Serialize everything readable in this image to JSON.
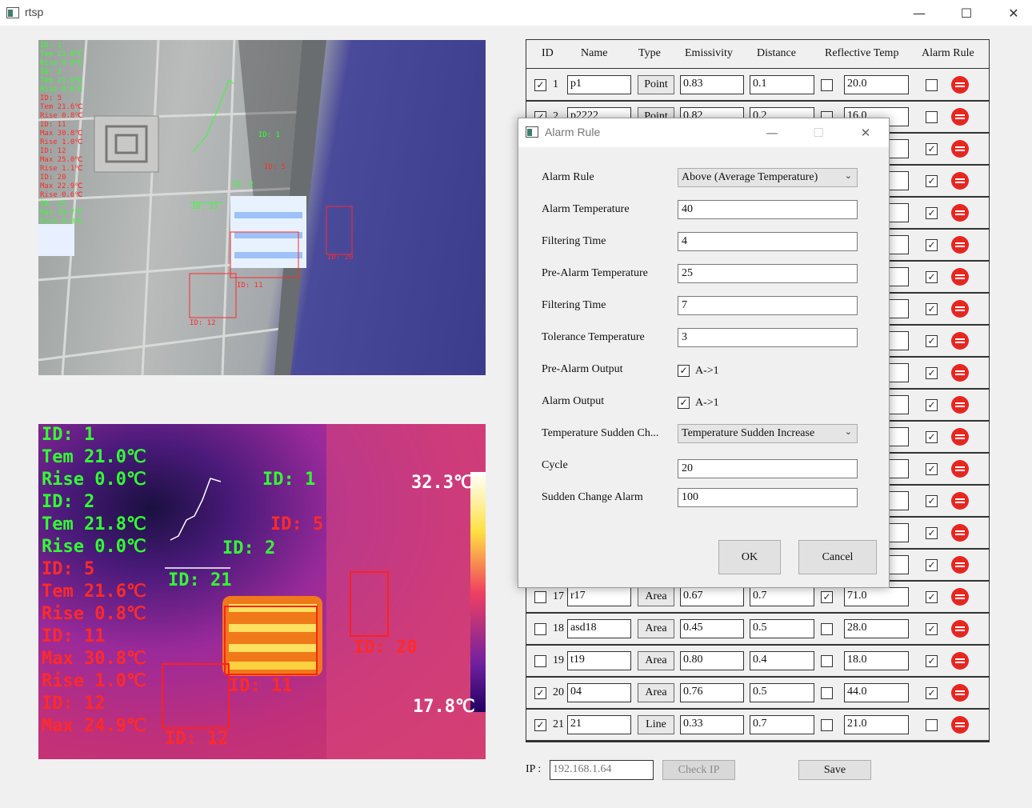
{
  "window": {
    "title": "rtsp",
    "minimize": "—",
    "maximize": "☐",
    "close": "✕"
  },
  "visible_view": {
    "overlay_lines": [
      {
        "text": "ID: 1",
        "color": "g"
      },
      {
        "text": "Tem  21.0℃",
        "color": "g"
      },
      {
        "text": "Rise  0.0℃",
        "color": "g"
      },
      {
        "text": "ID: 2",
        "color": "g"
      },
      {
        "text": "Tem  21.9℃",
        "color": "g"
      },
      {
        "text": "Rise  0.0℃",
        "color": "g"
      },
      {
        "text": "ID: 5",
        "color": "r"
      },
      {
        "text": "Tem  21.6℃",
        "color": "r"
      },
      {
        "text": "Rise  0.8℃",
        "color": "r"
      },
      {
        "text": "ID: 11",
        "color": "r"
      },
      {
        "text": "Max  30.8℃",
        "color": "r"
      },
      {
        "text": "Rise  1.0℃",
        "color": "r"
      },
      {
        "text": "ID: 12",
        "color": "r"
      },
      {
        "text": "Max  25.0℃",
        "color": "r"
      },
      {
        "text": "Rise  1.1℃",
        "color": "r"
      },
      {
        "text": "ID: 20",
        "color": "r"
      },
      {
        "text": "Max  22.9℃",
        "color": "r"
      },
      {
        "text": "Rise  0.6℃",
        "color": "r"
      },
      {
        "text": "ID: 21",
        "color": "g"
      },
      {
        "text": "Max  19.7℃",
        "color": "g"
      },
      {
        "text": "Rise  0.0℃",
        "color": "g"
      }
    ],
    "labels": {
      "id1": "ID: 1",
      "id5": "ID: 5",
      "id2": "ID: 2",
      "id21": "ID: 21",
      "id11": "ID: 11",
      "id12": "ID: 12",
      "id20": "ID: 20"
    }
  },
  "thermal_view": {
    "overlay_lines": [
      {
        "text": "ID: 1",
        "color": "g"
      },
      {
        "text": "Tem  21.0℃",
        "color": "g"
      },
      {
        "text": "Rise  0.0℃",
        "color": "g"
      },
      {
        "text": "ID: 2",
        "color": "g"
      },
      {
        "text": "Tem  21.8℃",
        "color": "g"
      },
      {
        "text": "Rise  0.0℃",
        "color": "g"
      },
      {
        "text": "ID: 5",
        "color": "r"
      },
      {
        "text": "Tem  21.6℃",
        "color": "r"
      },
      {
        "text": "Rise  0.8℃",
        "color": "r"
      },
      {
        "text": "ID: 11",
        "color": "r"
      },
      {
        "text": "Max  30.8℃",
        "color": "r"
      },
      {
        "text": "Rise  1.0℃",
        "color": "r"
      },
      {
        "text": "ID: 12",
        "color": "r"
      },
      {
        "text": "Max  24.9℃",
        "color": "r"
      }
    ],
    "labels": {
      "id1": "ID: 1",
      "id5": "ID: 5",
      "id2": "ID: 2",
      "id21": "ID: 21",
      "id11": "ID: 11",
      "id12": "ID: 12",
      "id20": "ID: 20"
    },
    "scale_max": "32.3℃",
    "scale_min": "17.8℃"
  },
  "table": {
    "headers": {
      "id": "ID",
      "name": "Name",
      "type": "Type",
      "emissivity": "Emissivity",
      "distance": "Distance",
      "reflective": "Reflective Temp",
      "alarm": "Alarm Rule"
    },
    "rows": [
      {
        "checked": true,
        "id": "1",
        "name": "p1",
        "type": "Point",
        "emissivity": "0.83",
        "distance": "0.1",
        "refl_on": false,
        "refl": "20.0",
        "alarm_on": false
      },
      {
        "checked": true,
        "id": "2",
        "name": "p2222",
        "type": "Point",
        "emissivity": "0.82",
        "distance": "0.2",
        "refl_on": false,
        "refl": "16.0",
        "alarm_on": false
      },
      {
        "checked": false,
        "id": "",
        "name": "",
        "type": "",
        "emissivity": "",
        "distance": "",
        "refl_on": false,
        "refl": "",
        "alarm_on": true
      },
      {
        "checked": false,
        "id": "",
        "name": "",
        "type": "",
        "emissivity": "",
        "distance": "",
        "refl_on": false,
        "refl": "",
        "alarm_on": true
      },
      {
        "checked": false,
        "id": "",
        "name": "",
        "type": "",
        "emissivity": "",
        "distance": "",
        "refl_on": false,
        "refl": "",
        "alarm_on": true
      },
      {
        "checked": false,
        "id": "",
        "name": "",
        "type": "",
        "emissivity": "",
        "distance": "",
        "refl_on": false,
        "refl": "",
        "alarm_on": true
      },
      {
        "checked": false,
        "id": "",
        "name": "",
        "type": "",
        "emissivity": "",
        "distance": "",
        "refl_on": false,
        "refl": "",
        "alarm_on": true
      },
      {
        "checked": false,
        "id": "",
        "name": "",
        "type": "",
        "emissivity": "",
        "distance": "",
        "refl_on": false,
        "refl": "",
        "alarm_on": true
      },
      {
        "checked": false,
        "id": "",
        "name": "",
        "type": "",
        "emissivity": "",
        "distance": "",
        "refl_on": false,
        "refl": "",
        "alarm_on": true
      },
      {
        "checked": false,
        "id": "",
        "name": "",
        "type": "",
        "emissivity": "",
        "distance": "",
        "refl_on": false,
        "refl": "",
        "alarm_on": true
      },
      {
        "checked": false,
        "id": "",
        "name": "",
        "type": "",
        "emissivity": "",
        "distance": "",
        "refl_on": false,
        "refl": "",
        "alarm_on": true
      },
      {
        "checked": false,
        "id": "",
        "name": "",
        "type": "",
        "emissivity": "",
        "distance": "",
        "refl_on": false,
        "refl": "",
        "alarm_on": true
      },
      {
        "checked": false,
        "id": "",
        "name": "",
        "type": "",
        "emissivity": "",
        "distance": "",
        "refl_on": false,
        "refl": "",
        "alarm_on": true
      },
      {
        "checked": false,
        "id": "",
        "name": "",
        "type": "",
        "emissivity": "",
        "distance": "",
        "refl_on": false,
        "refl": "",
        "alarm_on": true
      },
      {
        "checked": false,
        "id": "",
        "name": "",
        "type": "",
        "emissivity": "",
        "distance": "",
        "refl_on": false,
        "refl": "",
        "alarm_on": true
      },
      {
        "checked": false,
        "id": "",
        "name": "",
        "type": "",
        "emissivity": "",
        "distance": "",
        "refl_on": false,
        "refl": "",
        "alarm_on": true
      },
      {
        "checked": false,
        "id": "17",
        "name": "r17",
        "type": "Area",
        "emissivity": "0.67",
        "distance": "0.7",
        "refl_on": true,
        "refl": "71.0",
        "alarm_on": true
      },
      {
        "checked": false,
        "id": "18",
        "name": "asd18",
        "type": "Area",
        "emissivity": "0.45",
        "distance": "0.5",
        "refl_on": false,
        "refl": "28.0",
        "alarm_on": true
      },
      {
        "checked": false,
        "id": "19",
        "name": "t19",
        "type": "Area",
        "emissivity": "0.80",
        "distance": "0.4",
        "refl_on": false,
        "refl": "18.0",
        "alarm_on": true
      },
      {
        "checked": true,
        "id": "20",
        "name": "04",
        "type": "Area",
        "emissivity": "0.76",
        "distance": "0.5",
        "refl_on": false,
        "refl": "44.0",
        "alarm_on": true
      },
      {
        "checked": true,
        "id": "21",
        "name": "21",
        "type": "Line",
        "emissivity": "0.33",
        "distance": "0.7",
        "refl_on": false,
        "refl": "21.0",
        "alarm_on": false
      }
    ]
  },
  "bottom": {
    "ip_label": "IP :",
    "ip_placeholder": "192.168.1.64",
    "check_ip": "Check IP",
    "save": "Save"
  },
  "dialog": {
    "title": "Alarm Rule",
    "close": "✕",
    "minimize": "—",
    "maximize": "☐",
    "fields": {
      "alarm_rule_label": "Alarm Rule",
      "alarm_rule_value": "Above (Average Temperature)",
      "alarm_temp_label": "Alarm Temperature",
      "alarm_temp_value": "40",
      "filtering_time_label": "Filtering Time",
      "filtering_time_value": "4",
      "pre_alarm_temp_label": "Pre-Alarm Temperature",
      "pre_alarm_temp_value": "25",
      "filtering_time2_label": "Filtering Time",
      "filtering_time2_value": "7",
      "tolerance_label": "Tolerance Temperature",
      "tolerance_value": "3",
      "pre_alarm_output_label": "Pre-Alarm Output",
      "pre_alarm_output_check": "A->1",
      "alarm_output_label": "Alarm Output",
      "alarm_output_check": "A->1",
      "sudden_label": "Temperature Sudden Ch...",
      "sudden_value": "Temperature Sudden Increase",
      "cycle_label": "Cycle",
      "cycle_value": "20",
      "sudden_alarm_label": "Sudden Change Alarm",
      "sudden_alarm_value": "100"
    },
    "ok": "OK",
    "cancel": "Cancel"
  }
}
